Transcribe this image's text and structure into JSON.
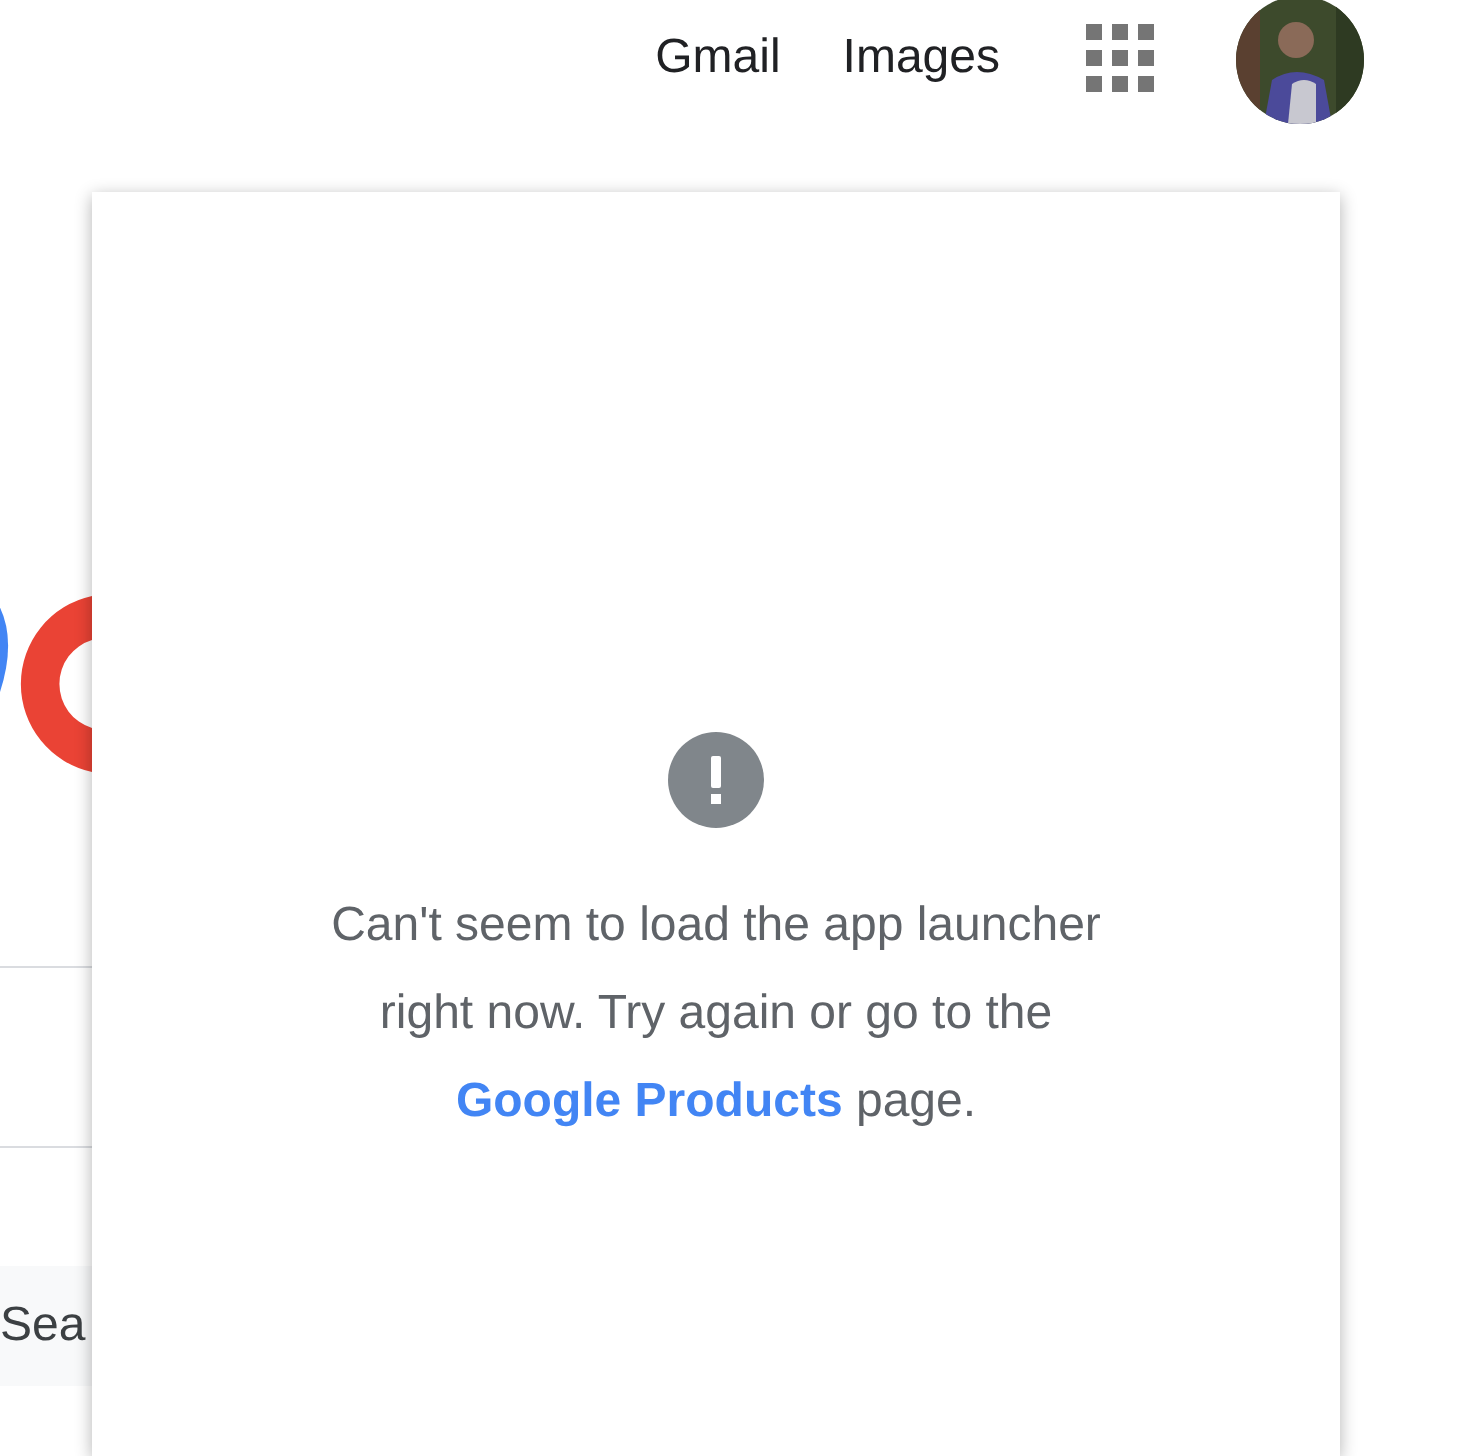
{
  "header": {
    "links": [
      "Gmail",
      "Images"
    ]
  },
  "background": {
    "search_button": "Sea"
  },
  "launcher_error": {
    "message_before": "Can't seem to load the app launcher right now. Try again or go to the ",
    "link": "Google Products",
    "message_after": " page."
  }
}
